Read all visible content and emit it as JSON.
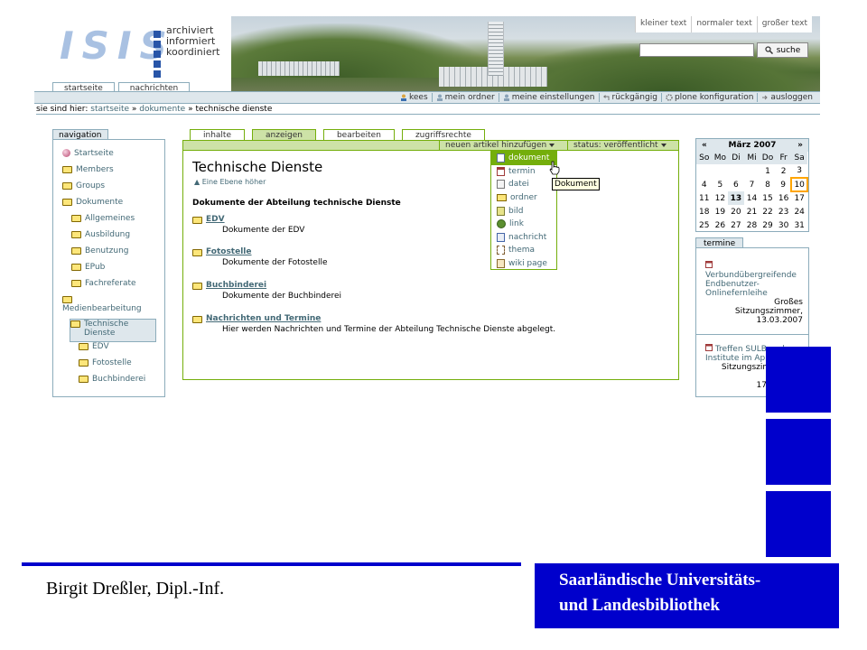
{
  "header": {
    "logo_text": "ISIS",
    "logo_tagline": [
      "archiviert",
      "informiert",
      "koordiniert"
    ],
    "text_size_links": [
      "kleiner text",
      "normaler text",
      "großer text"
    ],
    "search_input": "",
    "search_button": "suche",
    "top_tabs": [
      "startseite",
      "nachrichten"
    ],
    "personal_bar": [
      "kees",
      "mein ordner",
      "meine einstellungen",
      "rückgängig",
      "plone konfiguration",
      "ausloggen"
    ]
  },
  "breadcrumb": {
    "prefix": "sie sind hier:",
    "items": [
      "startseite",
      "dokumente"
    ],
    "current": "technische dienste",
    "separator": "»"
  },
  "navigation": {
    "title": "navigation",
    "items": [
      {
        "label": "Startseite",
        "level": 0,
        "icon": "home-icon"
      },
      {
        "label": "Members",
        "level": 0,
        "icon": "folder-icon"
      },
      {
        "label": "Groups",
        "level": 0,
        "icon": "folder-icon"
      },
      {
        "label": "Dokumente",
        "level": 0,
        "icon": "folder-icon"
      },
      {
        "label": "Allgemeines",
        "level": 1,
        "icon": "folder-icon"
      },
      {
        "label": "Ausbildung",
        "level": 1,
        "icon": "folder-icon"
      },
      {
        "label": "Benutzung",
        "level": 1,
        "icon": "folder-icon"
      },
      {
        "label": "EPub",
        "level": 1,
        "icon": "folder-icon"
      },
      {
        "label": "Fachreferate",
        "level": 1,
        "icon": "folder-icon"
      },
      {
        "label": "Medienbearbeitung",
        "level": 1,
        "icon": "folder-icon"
      },
      {
        "label": "Technische Dienste",
        "level": 1,
        "icon": "folder-icon",
        "selected": true
      },
      {
        "label": "EDV",
        "level": 2,
        "icon": "folder-icon"
      },
      {
        "label": "Fotostelle",
        "level": 2,
        "icon": "folder-icon"
      },
      {
        "label": "Buchbinderei",
        "level": 2,
        "icon": "folder-icon"
      }
    ]
  },
  "content_tabs": [
    "inhalte",
    "anzeigen",
    "bearbeiten",
    "zugriffsrechte"
  ],
  "content_tabs_active": "anzeigen",
  "actions": {
    "add_item": "neuen artikel hinzufügen",
    "status": "status: veröffentlicht"
  },
  "page": {
    "title": "Technische Dienste",
    "up_link": "Eine Ebene höher",
    "description": "Dokumente der Abteilung technische Dienste",
    "entries": [
      {
        "title": "EDV",
        "description": "Dokumente der EDV"
      },
      {
        "title": "Fotostelle",
        "description": "Dokumente der Fotostelle"
      },
      {
        "title": "Buchbinderei",
        "description": "Dokumente der Buchbinderei"
      },
      {
        "title": "Nachrichten und Termine",
        "description": "Hier werden Nachrichten und Termine der Abteilung Technische Dienste abgelegt."
      }
    ]
  },
  "add_menu": {
    "items": [
      "dokument",
      "termin",
      "datei",
      "ordner",
      "bild",
      "link",
      "nachricht",
      "thema",
      "wiki page"
    ],
    "highlighted": "dokument",
    "tooltip": "Dokument"
  },
  "calendar": {
    "prev": "«",
    "next": "»",
    "month": "März 2007",
    "weekdays": [
      "So",
      "Mo",
      "Di",
      "Mi",
      "Do",
      "Fr",
      "Sa"
    ],
    "weeks": [
      [
        "",
        "",
        "",
        "",
        "1",
        "2",
        "3"
      ],
      [
        "4",
        "5",
        "6",
        "7",
        "8",
        "9",
        "10"
      ],
      [
        "11",
        "12",
        "13",
        "14",
        "15",
        "16",
        "17"
      ],
      [
        "18",
        "19",
        "20",
        "21",
        "22",
        "23",
        "24"
      ],
      [
        "25",
        "26",
        "27",
        "28",
        "29",
        "30",
        "31"
      ]
    ],
    "highlighted_day": "13",
    "today": "10"
  },
  "termine": {
    "title": "termine",
    "events": [
      {
        "title": "Verbundübergreifende Endbenutzer-Onlinefernleihe",
        "location": "Großes Sitzungszimmer,",
        "date": "13.03.2007"
      },
      {
        "title": "Treffen SULB und Institute im April",
        "location": "Sitzungszimmer der SULB,",
        "date": "17.04.2007"
      }
    ]
  },
  "slide": {
    "author": "Birgit Dreßler, Dipl.-Inf.",
    "institution_line1": "Saarländische Universitäts-",
    "institution_line2": "und Landesbibliothek",
    "accent_color": "#0000cc"
  }
}
